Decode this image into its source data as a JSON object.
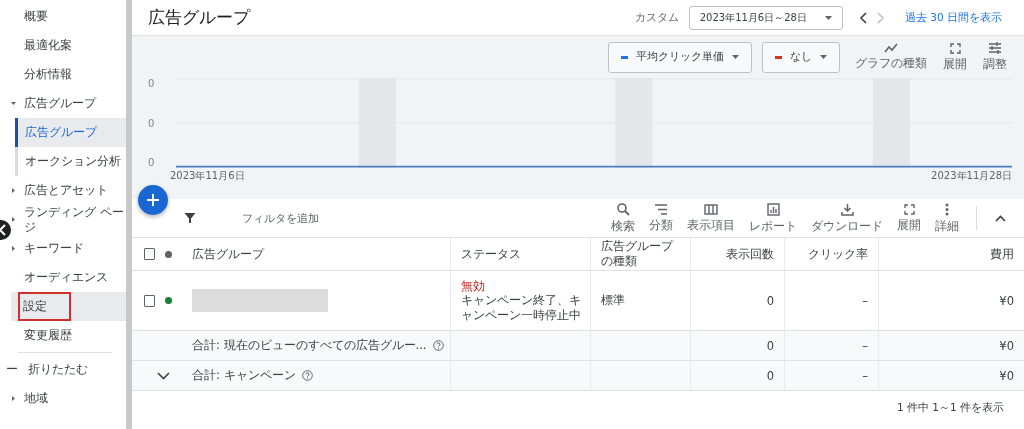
{
  "sidebar": {
    "items": [
      {
        "label": "概要",
        "selected": false
      },
      {
        "label": "最適化案",
        "selected": false
      },
      {
        "label": "分析情報",
        "selected": false
      },
      {
        "label": "広告グループ",
        "selected": false,
        "expanded": true,
        "children": [
          {
            "label": "広告グループ",
            "selected": true
          },
          {
            "label": "オークション分析",
            "selected": false
          }
        ]
      },
      {
        "label": "広告とアセット",
        "selected": false,
        "expanded": false
      },
      {
        "label": "ランディング ページ",
        "selected": false,
        "expanded": false
      },
      {
        "label": "キーワード",
        "selected": false,
        "expanded": false
      },
      {
        "label": "オーディエンス",
        "selected": false
      },
      {
        "label": "設定",
        "selected": false,
        "marked": true
      },
      {
        "label": "変更履歴",
        "selected": false
      }
    ],
    "collapse": {
      "icon": "ー",
      "label": "折りたたむ"
    },
    "after": [
      {
        "label": "地域",
        "selected": false,
        "expanded": false
      }
    ]
  },
  "header": {
    "title": "広告グループ",
    "range_label": "カスタム",
    "date_range": "2023年11月6日～28日",
    "link": "過去 30 日間を表示"
  },
  "chart": {
    "metrics": [
      {
        "label": "平均クリック単価",
        "color": "#1a73e8"
      },
      {
        "label": "なし",
        "color": "#d93025"
      }
    ],
    "tools": [
      {
        "kind": "chart-type",
        "label": "グラフの種類"
      },
      {
        "kind": "expand",
        "label": "展開"
      },
      {
        "kind": "adjust",
        "label": "調整"
      }
    ],
    "y_labels": [
      "0",
      "0",
      "0"
    ],
    "x_start": "2023年11月6日",
    "x_end": "2023年11月28日"
  },
  "toolbar": {
    "filter": "フィルタを追加",
    "tools": [
      {
        "kind": "search",
        "label": "検索"
      },
      {
        "kind": "segment",
        "label": "分類"
      },
      {
        "kind": "columns",
        "label": "表示項目"
      },
      {
        "kind": "report",
        "label": "レポート"
      },
      {
        "kind": "download",
        "label": "ダウンロード"
      },
      {
        "kind": "expand",
        "label": "展開"
      },
      {
        "kind": "more",
        "label": "詳細"
      }
    ]
  },
  "table": {
    "select_all": {
      "checked": false
    },
    "columns": [
      "広告グループ",
      "ステータス",
      "広告グループの種類",
      "表示回数",
      "クリック率",
      "費用"
    ],
    "rows": [
      {
        "checked": false,
        "color": "#188038",
        "status": "無効",
        "status_detail": "キャンペーン終了、キャンペーン一時停止中",
        "type": "標準",
        "impressions": "0",
        "ctr": "–",
        "cost": "¥0"
      }
    ],
    "totals": [
      {
        "label": "合計: 現在のビューのすべての広告グルー...",
        "impressions": "0",
        "ctr": "–",
        "cost": "¥0"
      },
      {
        "label": "合計: キャンペーン",
        "impressions": "0",
        "ctr": "–",
        "cost": "¥0"
      }
    ],
    "footer": "1 件中 1～1 件を表示"
  }
}
